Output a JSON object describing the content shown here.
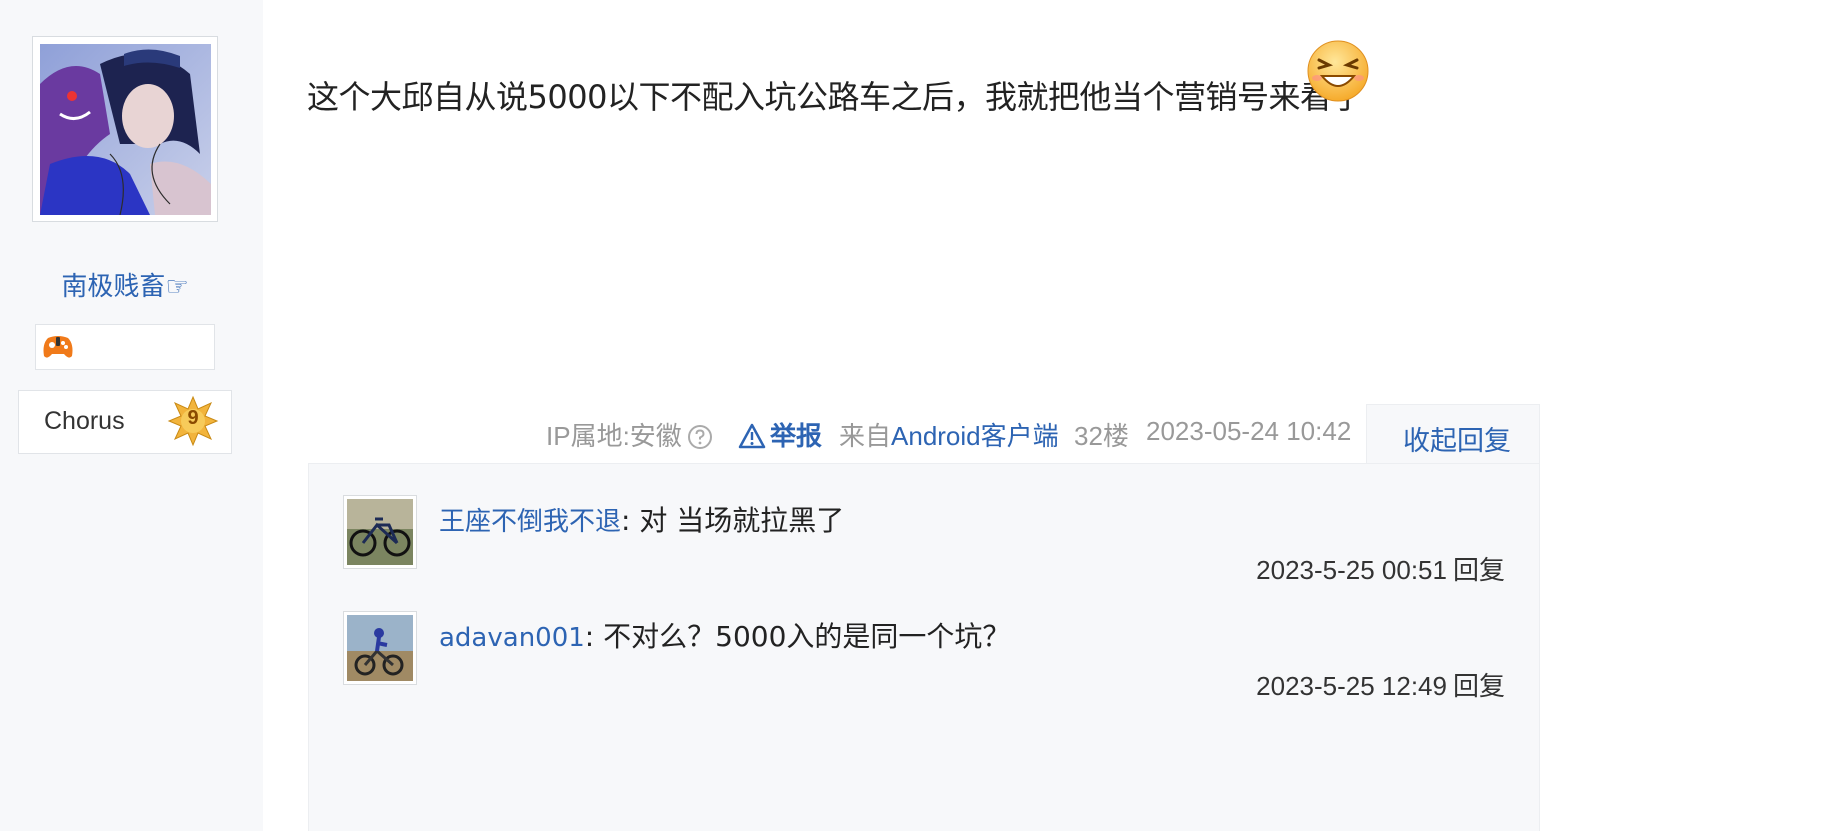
{
  "author": {
    "name": "南极贱畜☞",
    "avatar_icon": "anime-girl-avatar",
    "badge_icon": "game-controller-icon",
    "level_name": "Chorus",
    "level_number": "9",
    "level_color": "#e8a628"
  },
  "post": {
    "text": "这个大邱自从说5000以下不配入坑公路车之后，我就把他当个营销号来看了",
    "emoji_icon": "laughing-face-emoji",
    "ip_label": "IP属地:安徽",
    "help_icon": "question-circle-icon",
    "report_icon": "warning-triangle-icon",
    "report_label": "举报",
    "source_prefix": "来自",
    "source_client": "Android客户端",
    "floor": "32楼",
    "datetime": "2023-05-24 10:42",
    "collapse_label": "收起回复"
  },
  "replies": [
    {
      "user": "王座不倒我不退",
      "text": ": 对 当场就拉黑了",
      "time": "2023-5-25 00:51",
      "reply_label": "回复",
      "avatar_icon": "bicycle-avatar"
    },
    {
      "user": "adavan001",
      "text": ": 不对么？5000入的是同一个坑？",
      "time": "2023-5-25 12:49",
      "reply_label": "回复",
      "avatar_icon": "mountain-biker-avatar"
    }
  ],
  "colors": {
    "link": "#2d64b3",
    "muted": "#999999",
    "panel": "#f7f8fa"
  }
}
